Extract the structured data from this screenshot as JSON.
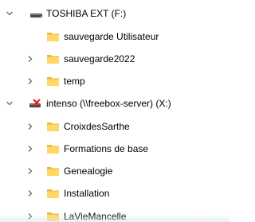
{
  "tree": {
    "drive_toshiba": {
      "label": "TOSHIBA EXT (F:)",
      "expanded": true,
      "icon": "usb-drive-icon"
    },
    "toshiba_children": [
      {
        "label": "sauvegarde Utilisateur",
        "has_children": false
      },
      {
        "label": "sauvegarde2022",
        "has_children": true
      },
      {
        "label": "temp",
        "has_children": true
      }
    ],
    "drive_intenso": {
      "label": "intenso (\\\\freebox-server) (X:)",
      "expanded": true,
      "icon": "network-drive-disconnected-icon"
    },
    "intenso_children": [
      {
        "label": "CroixdesSarthe",
        "has_children": true
      },
      {
        "label": "Formations de base",
        "has_children": true
      },
      {
        "label": "Genealogie",
        "has_children": true
      },
      {
        "label": "Installation",
        "has_children": true
      },
      {
        "label": "LaVieMancelle",
        "has_children": true
      }
    ]
  },
  "colors": {
    "folder_yellow": "#ffd866",
    "folder_dark": "#e8b43a",
    "chevron": "#6b6b6b",
    "drive_gray": "#4a4a4a",
    "disconnect_red": "#e02020"
  }
}
